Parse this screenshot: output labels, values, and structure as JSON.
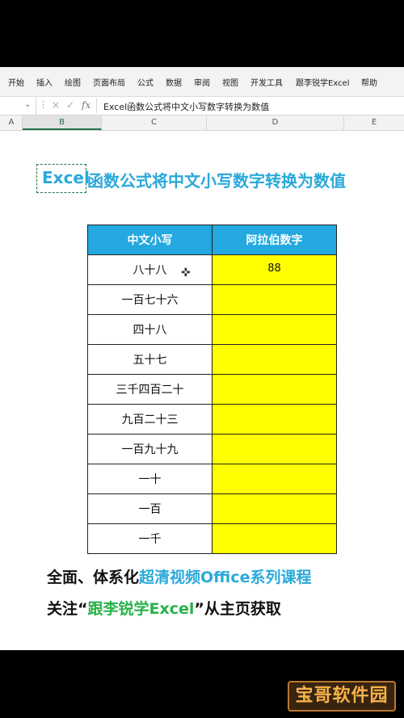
{
  "ribbon": {
    "tabs": [
      "开始",
      "插入",
      "绘图",
      "页面布局",
      "公式",
      "数据",
      "审阅",
      "视图",
      "开发工具",
      "跟李锐学Excel",
      "帮助"
    ]
  },
  "formula_bar": {
    "cancel_glyph": "×",
    "confirm_glyph": "✓",
    "fx_label": "fx",
    "content": "Excel函数公式将中文小写数字转换为数值"
  },
  "columns": [
    "A",
    "B",
    "C",
    "D",
    "E"
  ],
  "title": {
    "prefix": "Excel",
    "rest": "函数公式将中文小写数字转换为数值"
  },
  "table": {
    "headers": [
      "中文小写",
      "阿拉伯数字"
    ],
    "rows": [
      {
        "cn": "八十八",
        "num": "88"
      },
      {
        "cn": "一百七十六",
        "num": ""
      },
      {
        "cn": "四十八",
        "num": ""
      },
      {
        "cn": "五十七",
        "num": ""
      },
      {
        "cn": "三千四百二十",
        "num": ""
      },
      {
        "cn": "九百二十三",
        "num": ""
      },
      {
        "cn": "一百九十九",
        "num": ""
      },
      {
        "cn": "一十",
        "num": ""
      },
      {
        "cn": "一百",
        "num": ""
      },
      {
        "cn": "一千",
        "num": ""
      }
    ]
  },
  "promo": {
    "line1_a": "全面、体系化",
    "line1_b": "超清视频Office系列课程",
    "line2_a": "关注“",
    "line2_b": "跟李锐学Excel",
    "line2_c": "”从主页获取"
  },
  "watermark": "宝哥软件园",
  "colors": {
    "header_blue": "#23a8df",
    "value_yellow": "#ffff00",
    "title_blue": "#2aa9d9",
    "accent_green": "#27b34a"
  }
}
